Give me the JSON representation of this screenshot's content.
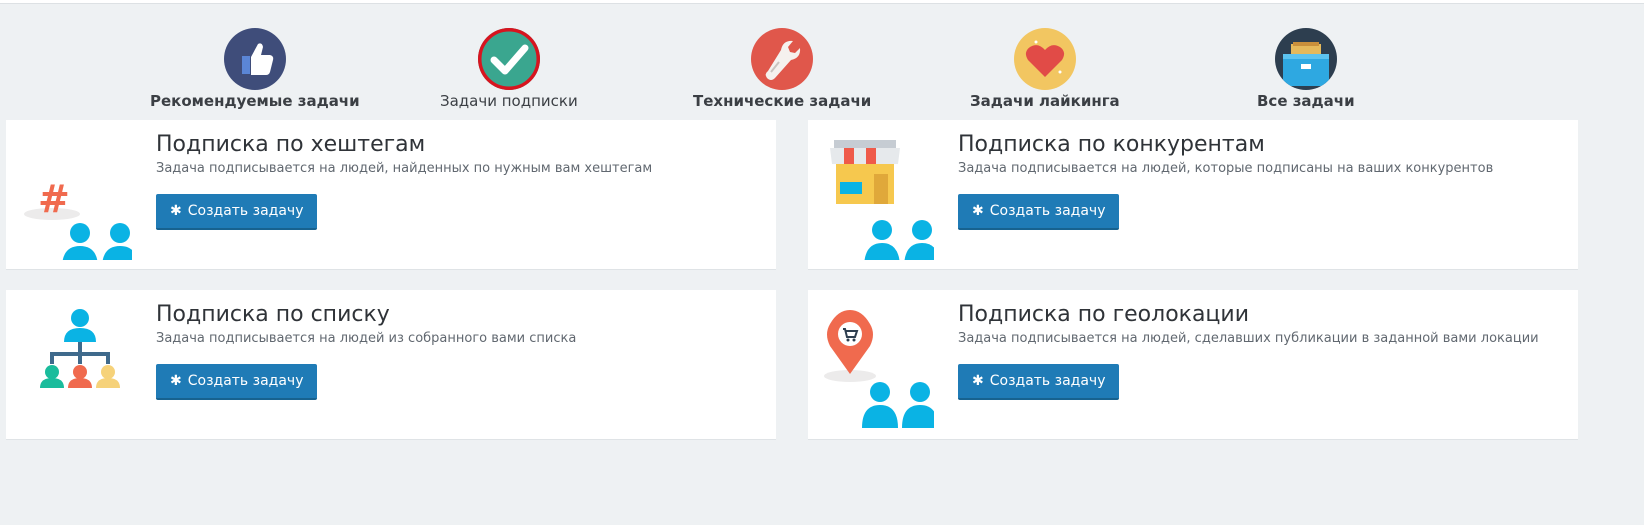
{
  "categories": [
    {
      "label": "Рекомендуемые задачи",
      "icon": "thumbs-up-icon",
      "color": "#3f4d7a"
    },
    {
      "label": "Задачи подписки",
      "icon": "checkmark-icon",
      "color": "#3aa68f",
      "selected": true
    },
    {
      "label": "Технические задачи",
      "icon": "wrench-icon",
      "color": "#e0574b"
    },
    {
      "label": "Задачи лайкинга",
      "icon": "heart-icon",
      "color": "#f2c661"
    },
    {
      "label": "Все задачи",
      "icon": "archive-box-icon",
      "color": "#2d3e4f"
    }
  ],
  "tasks": [
    {
      "title": "Подписка по хештегам",
      "description": "Задача подписывается на людей, найденных по нужным вам хештегам",
      "button": "Создать задачу",
      "icon": "hashtag-users-icon"
    },
    {
      "title": "Подписка по конкурентам",
      "description": "Задача подписывается на людей, которые подписаны на ваших конкурентов",
      "button": "Создать задачу",
      "icon": "store-users-icon"
    },
    {
      "title": "Подписка по списку",
      "description": "Задача подписывается на людей из собранного вами списка",
      "button": "Создать задачу",
      "icon": "org-list-icon"
    },
    {
      "title": "Подписка по геолокации",
      "description": "Задача подписывается на людей, сделавших публикации в заданной вами локации",
      "button": "Создать задачу",
      "icon": "location-pin-users-icon"
    }
  ],
  "colors": {
    "accent": "#1f7bb6",
    "background": "#eef1f3",
    "user_icon": "#0ab3e4"
  }
}
